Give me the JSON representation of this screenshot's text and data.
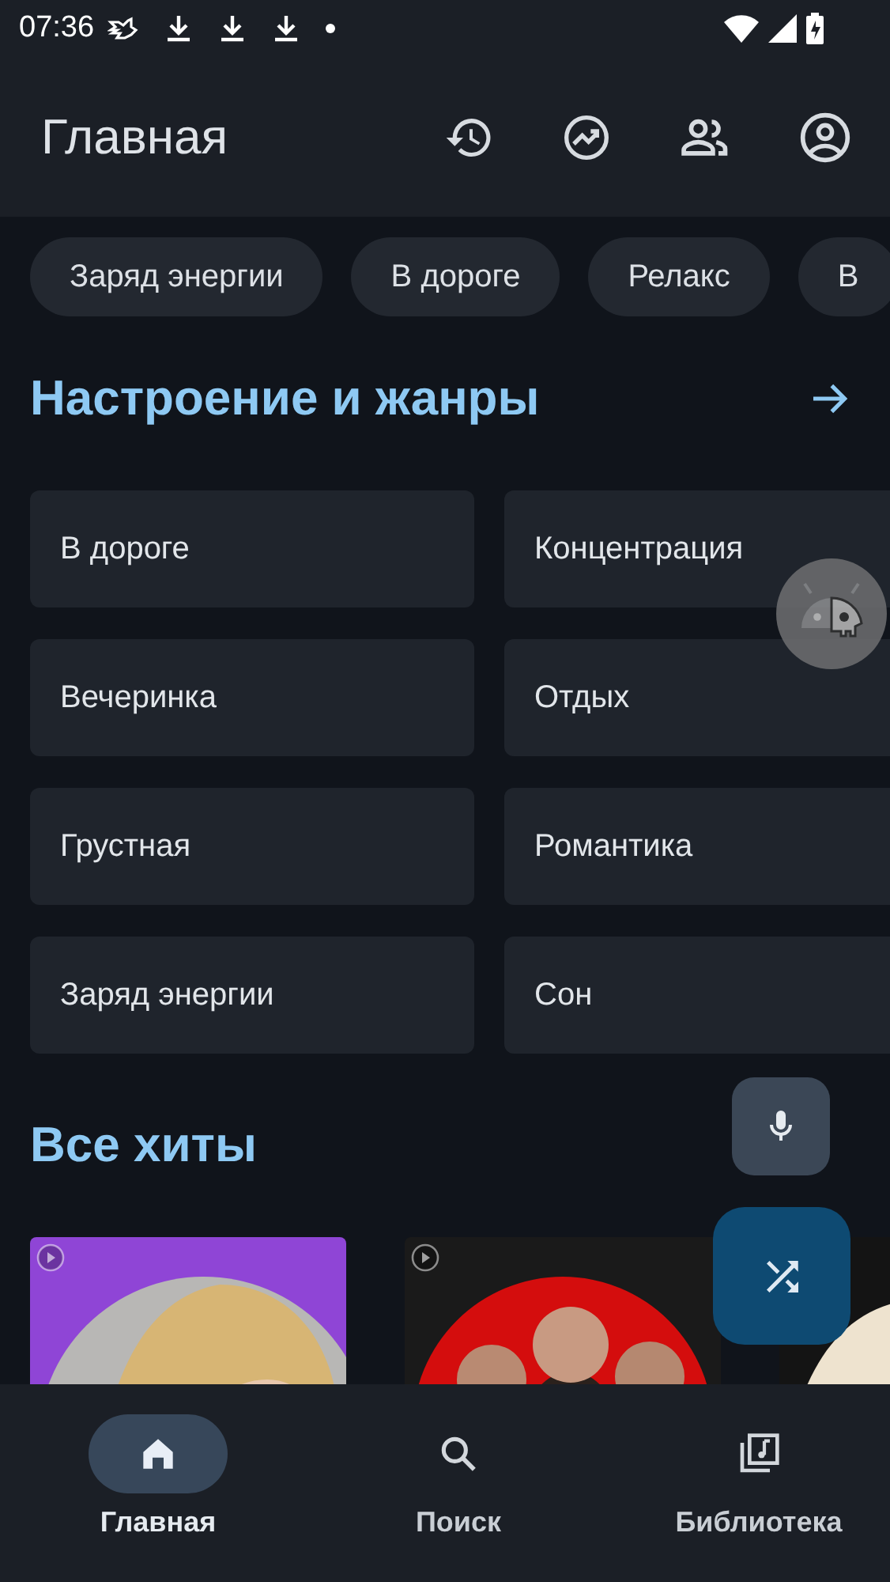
{
  "status_bar": {
    "time": "07:36"
  },
  "app_bar": {
    "title": "Главная"
  },
  "chips": [
    {
      "label": "Заряд энергии"
    },
    {
      "label": "В дороге"
    },
    {
      "label": "Релакс"
    },
    {
      "label": "В"
    }
  ],
  "moods": {
    "title": "Настроение и жанры",
    "tiles": [
      {
        "label": "В дороге"
      },
      {
        "label": "Концентрация"
      },
      {
        "label": "Вечеринка"
      },
      {
        "label": "Отдых"
      },
      {
        "label": "Грустная"
      },
      {
        "label": "Романтика"
      },
      {
        "label": "Заряд энергии"
      },
      {
        "label": "Сон"
      }
    ]
  },
  "hits": {
    "title": "Все хиты",
    "items": [
      {
        "kind": "picture",
        "play_badge": true
      },
      {
        "kind": "picture",
        "play_badge": true
      },
      {
        "kind": "picture"
      }
    ]
  },
  "bottom_nav": [
    {
      "label": "Главная",
      "kind": "home",
      "selected": true
    },
    {
      "label": "Поиск",
      "kind": "search",
      "selected": false
    },
    {
      "label": "Библиотека",
      "kind": "library",
      "selected": false
    }
  ]
}
